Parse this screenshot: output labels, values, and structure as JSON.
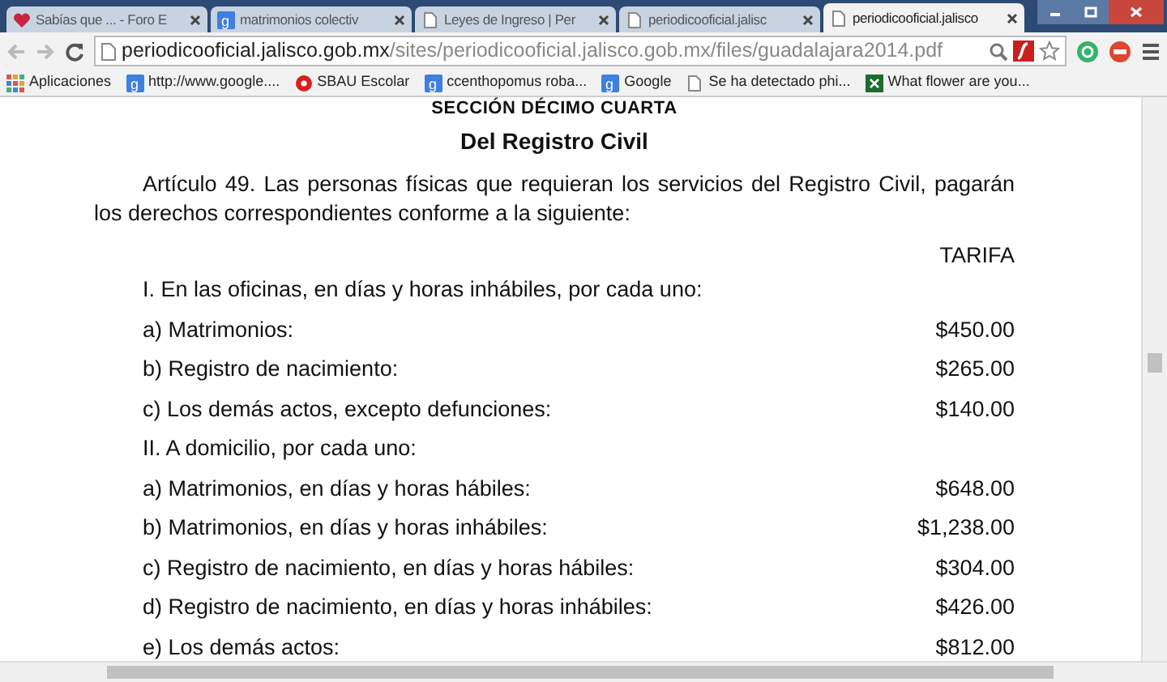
{
  "tabs": [
    {
      "title": "Sabías que ... - Foro E",
      "kind": "heart",
      "selected": false
    },
    {
      "title": "matrimonios colectiv",
      "kind": "g",
      "selected": false
    },
    {
      "title": "Leyes de Ingreso | Per",
      "kind": "page",
      "selected": false
    },
    {
      "title": "periodicooficial.jalisc",
      "kind": "page",
      "selected": false
    },
    {
      "title": "periodicooficial.jalisco",
      "kind": "page",
      "selected": true
    }
  ],
  "address": {
    "host": "periodicooficial.jalisco.gob.mx",
    "path": "/sites/periodicooficial.jalisco.gob.mx/files/guadalajara2014.pdf"
  },
  "bookmarks": [
    {
      "label": "Aplicaciones",
      "kind": "apps"
    },
    {
      "label": "http://www.google....",
      "kind": "g"
    },
    {
      "label": "SBAU Escolar",
      "kind": "red"
    },
    {
      "label": "ccenthopomus roba...",
      "kind": "g"
    },
    {
      "label": "Google",
      "kind": "g"
    },
    {
      "label": "Se ha detectado phi...",
      "kind": "page"
    },
    {
      "label": "What flower are you...",
      "kind": "x"
    }
  ],
  "document": {
    "section": "SECCIÓN DÉCIMO CUARTA",
    "title": "Del Registro Civil",
    "paragraph": "Artículo 49. Las personas físicas que requieran los servicios del Registro Civil, pagarán los derechos correspondientes conforme a la siguiente:",
    "column_header": "TARIFA",
    "rows": [
      {
        "kind": "section",
        "label": "I. En las oficinas, en días y horas inhábiles, por cada uno:"
      },
      {
        "kind": "fee",
        "label": "a) Matrimonios:",
        "amount": "$450.00"
      },
      {
        "kind": "fee",
        "label": "b) Registro de nacimiento:",
        "amount": "$265.00"
      },
      {
        "kind": "fee",
        "label": "c) Los demás actos, excepto defunciones:",
        "amount": "$140.00"
      },
      {
        "kind": "section",
        "label": "II. A domicilio, por cada uno:"
      },
      {
        "kind": "fee",
        "label": "a) Matrimonios, en días y horas hábiles:",
        "amount": "$648.00"
      },
      {
        "kind": "fee",
        "label": "b) Matrimonios, en días y horas inhábiles:",
        "amount": "$1,238.00"
      },
      {
        "kind": "fee",
        "label": "c) Registro de nacimiento, en días y horas hábiles:",
        "amount": "$304.00"
      },
      {
        "kind": "fee",
        "label": "d) Registro de nacimiento, en días y horas inhábiles:",
        "amount": "$426.00"
      },
      {
        "kind": "fee",
        "label": "e) Los demás actos:",
        "amount": "$812.00"
      }
    ]
  }
}
